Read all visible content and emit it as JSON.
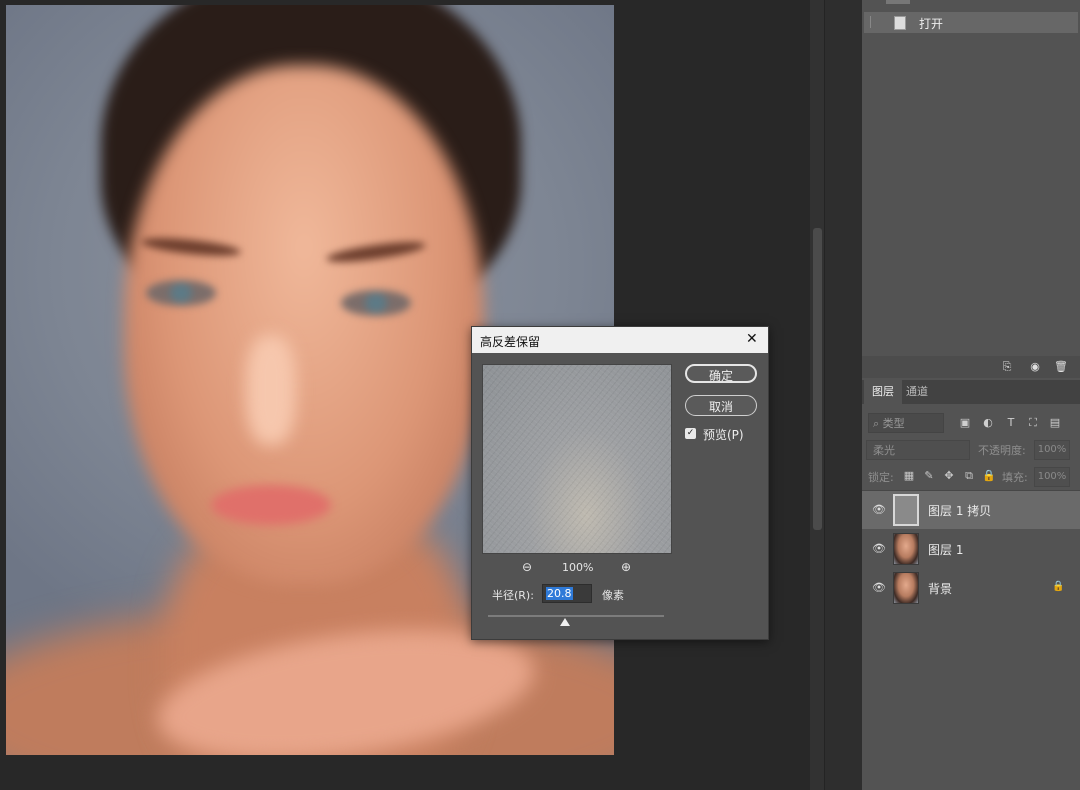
{
  "history": {
    "items": [
      {
        "label": "打开"
      }
    ]
  },
  "layers_panel": {
    "tabs": [
      {
        "label": "图层",
        "active": true
      },
      {
        "label": "通道",
        "active": false
      }
    ],
    "filter_placeholder": "类型",
    "blend_mode": "柔光",
    "opacity_label": "不透明度:",
    "opacity_value": "100%",
    "lock_label": "锁定:",
    "fill_label": "填充:",
    "fill_value": "100%",
    "layers": [
      {
        "name": "图层 1 拷贝",
        "visible": true,
        "selected": true,
        "locked": false,
        "thumb": "gray"
      },
      {
        "name": "图层 1",
        "visible": true,
        "selected": false,
        "locked": false,
        "thumb": "face"
      },
      {
        "name": "背景",
        "visible": true,
        "selected": false,
        "locked": true,
        "thumb": "face"
      }
    ]
  },
  "dialog": {
    "title": "高反差保留",
    "ok_label": "确定",
    "cancel_label": "取消",
    "preview_label": "预览(P)",
    "preview_checked": true,
    "zoom_value": "100%",
    "radius_label": "半径(R):",
    "radius_value": "20.8",
    "unit_label": "像素"
  },
  "icons": {
    "close": "close-icon",
    "zoom_out": "zoom-out-icon",
    "zoom_in": "zoom-in-icon",
    "eye": "eye-icon",
    "lock": "lock-icon"
  }
}
